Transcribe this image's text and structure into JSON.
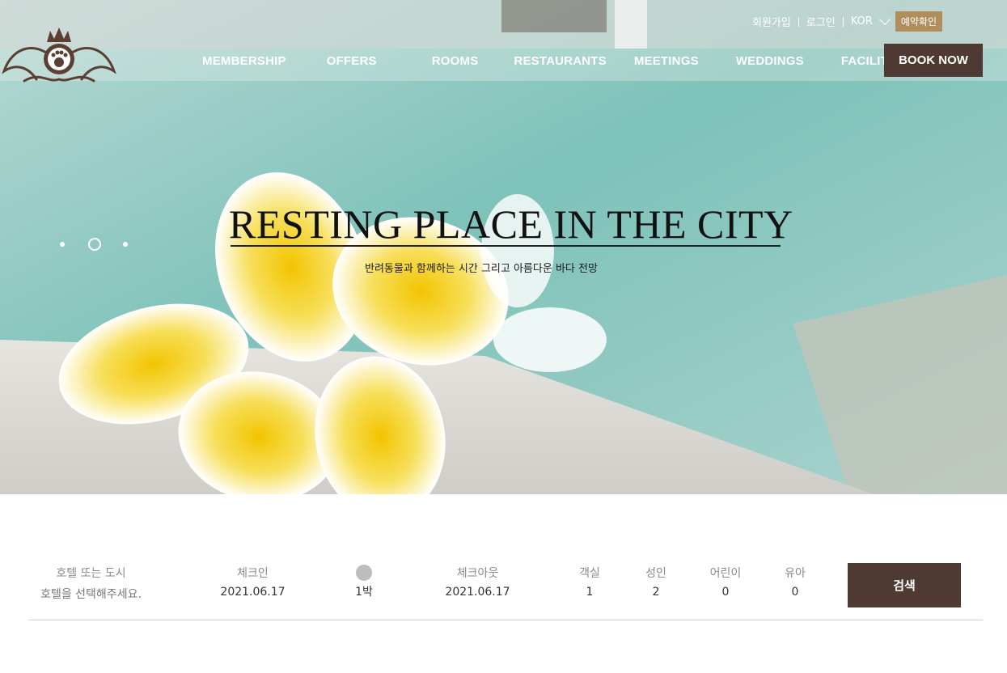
{
  "header": {
    "utility": {
      "signup": "회원가입",
      "login": "로그인",
      "language": "KOR",
      "reservation_check": "예약확인"
    },
    "nav": [
      "MEMBERSHIP",
      "OFFERS",
      "ROOMS",
      "RESTAURANTS",
      "MEETINGS",
      "WEDDINGS",
      "FACILITIES"
    ],
    "book_now": "BOOK NOW"
  },
  "hero": {
    "title": "RESTING PLACE IN THE CITY",
    "subtitle": "반려동물과 함께하는 시간 그리고 아름다운 바다 전망"
  },
  "booking": {
    "hotel_label": "호텔 또는 도시",
    "hotel_placeholder": "호텔을 선택해주세요.",
    "checkin_label": "체크인",
    "checkin_value": "2021.06.17",
    "nights": "1박",
    "checkout_label": "체크아웃",
    "checkout_value": "2021.06.17",
    "rooms_label": "객실",
    "rooms_value": "1",
    "adults_label": "성인",
    "adults_value": "2",
    "children_label": "어린이",
    "children_value": "0",
    "infants_label": "유아",
    "infants_value": "0",
    "search": "검색"
  },
  "colors": {
    "brand_brown": "#4e3a33",
    "reservation_gold": "#b08e5c"
  },
  "icons": [
    "crown-logo-icon",
    "chevron-down-icon",
    "moon-icon"
  ]
}
